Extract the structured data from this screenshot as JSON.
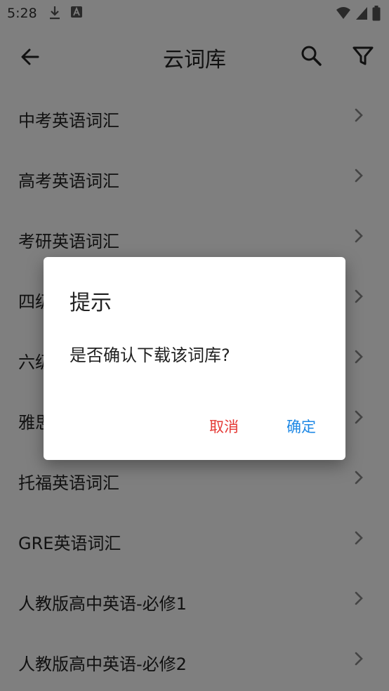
{
  "status_bar": {
    "time": "5:28",
    "icons": [
      "download-icon",
      "a-notification-icon",
      "wifi-icon",
      "signal-icon",
      "battery-icon"
    ]
  },
  "appbar": {
    "title": "云词库",
    "icons": [
      "back-arrow-icon",
      "search-icon",
      "filter-icon"
    ]
  },
  "list": {
    "items": [
      {
        "label": "中考英语词汇"
      },
      {
        "label": "高考英语词汇"
      },
      {
        "label": "考研英语词汇"
      },
      {
        "label": "四级英语词汇"
      },
      {
        "label": "六级英语词汇"
      },
      {
        "label": "雅思英语词汇"
      },
      {
        "label": "托福英语词汇"
      },
      {
        "label": "GRE英语词汇"
      },
      {
        "label": "人教版高中英语-必修1"
      },
      {
        "label": "人教版高中英语-必修2"
      }
    ]
  },
  "dialog": {
    "title": "提示",
    "message": "是否确认下载该词库?",
    "cancel_label": "取消",
    "ok_label": "确定"
  },
  "colors": {
    "cancel": "#e53935",
    "ok": "#1e88e5",
    "scrim": "rgba(0,0,0,0.5)"
  }
}
